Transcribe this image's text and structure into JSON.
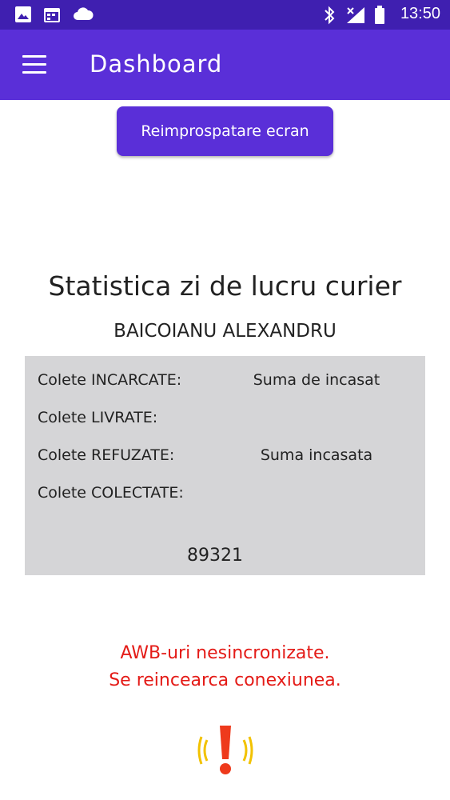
{
  "status_bar": {
    "time": "13:50",
    "left_icons": [
      "image-icon",
      "calendar-icon",
      "cloud-icon"
    ],
    "right_icons": [
      "bluetooth-icon",
      "signal-icon",
      "battery-icon"
    ]
  },
  "app_bar": {
    "title": "Dashboard",
    "menu_icon": "hamburger-menu-icon",
    "color": "#5a2fd8"
  },
  "refresh_button": {
    "label": "Reimprospatare ecran"
  },
  "stats": {
    "title": "Statistica zi de lucru curier",
    "courier_name": "BAICOIANU ALEXANDRU",
    "rows": [
      {
        "label": "Colete INCARCATE:"
      },
      {
        "label": "Colete LIVRATE:"
      },
      {
        "label": "Colete REFUZATE:"
      },
      {
        "label": "Colete COLECTATE:"
      }
    ],
    "amount_to_collect_label": "Suma de incasat",
    "amount_collected_label": "Suma incasata",
    "code": "89321"
  },
  "warning": {
    "line1": "AWB-uri nesincronizate.",
    "line2": "Se reincearca conexiunea.",
    "color": "#e41b17",
    "icon": "alert-vibrate-icon"
  }
}
